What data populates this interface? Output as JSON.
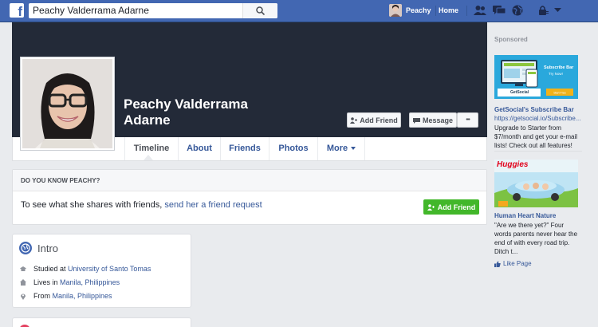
{
  "topbar": {
    "logo": "f",
    "search_value": "Peachy Valderrama Adarne",
    "user_name": "Peachy",
    "home_label": "Home",
    "icons": [
      "friend-requests-icon",
      "messages-icon",
      "notifications-icon",
      "privacy-shortcuts-icon",
      "account-menu-icon"
    ]
  },
  "profile": {
    "name": "Peachy Valderrama Adarne",
    "add_friend_label": "Add Friend",
    "message_label": "Message",
    "more_label": "•••"
  },
  "tabs": [
    {
      "label": "Timeline"
    },
    {
      "label": "About"
    },
    {
      "label": "Friends"
    },
    {
      "label": "Photos"
    },
    {
      "label": "More"
    }
  ],
  "know": {
    "heading": "DO YOU KNOW PEACHY?",
    "text": "To see what she shares with friends,",
    "link": "send her a friend request",
    "button_label": "Add Friend"
  },
  "intro": {
    "title": "Intro",
    "items": [
      {
        "prefix": "Studied at",
        "link": "University of Santo Tomas"
      },
      {
        "prefix": "Lives in",
        "link": "Manila, Philippines"
      },
      {
        "prefix": "From",
        "link": "Manila, Philippines"
      }
    ]
  },
  "sponsored": {
    "label": "Sponsored",
    "ads": [
      {
        "image_text_1": "Subscribe Bar",
        "image_text_2": "Try Now!",
        "image_brand": "GetSocial",
        "title": "GetSocial's Subscribe Bar",
        "url": "https://getsocial.io/Subscribe...",
        "body": "Upgrade to Starter from $7/month and get your e-mail lists! Check out all features!"
      },
      {
        "image_text": "Huggies",
        "title": "Human Heart Nature",
        "body": "\"Are we there yet?\" Four words parents never hear the end of with every road trip. Ditch t...",
        "like_label": "Like Page"
      }
    ]
  },
  "colors": {
    "brand_blue": "#4267b2",
    "link_blue": "#365899",
    "cover": "#232a38",
    "green": "#42b72a"
  }
}
